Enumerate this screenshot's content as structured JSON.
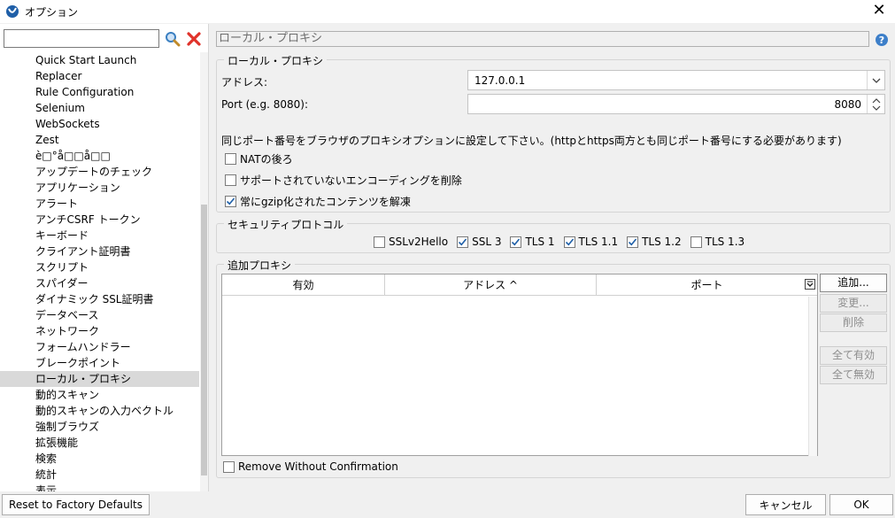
{
  "window": {
    "title": "オプション",
    "close_glyph": "✕"
  },
  "sidebar": {
    "search": {
      "value": "",
      "placeholder": ""
    },
    "items": [
      {
        "label": "Quick Start Launch"
      },
      {
        "label": "Replacer"
      },
      {
        "label": "Rule Configuration"
      },
      {
        "label": "Selenium"
      },
      {
        "label": "WebSockets"
      },
      {
        "label": "Zest"
      },
      {
        "label": "è□°å□□å□□"
      },
      {
        "label": "アップデートのチェック"
      },
      {
        "label": "アプリケーション"
      },
      {
        "label": "アラート"
      },
      {
        "label": "アンチCSRF トークン"
      },
      {
        "label": "キーボード"
      },
      {
        "label": "クライアント証明書"
      },
      {
        "label": "スクリプト"
      },
      {
        "label": "スパイダー"
      },
      {
        "label": "ダイナミック SSL証明書"
      },
      {
        "label": "データベース"
      },
      {
        "label": "ネットワーク"
      },
      {
        "label": "フォームハンドラー"
      },
      {
        "label": "ブレークポイント"
      },
      {
        "label": "ローカル・プロキシ",
        "selected": true
      },
      {
        "label": "動的スキャン"
      },
      {
        "label": "動的スキャンの入力ベクトル"
      },
      {
        "label": "強制ブラウズ"
      },
      {
        "label": "拡張機能"
      },
      {
        "label": "検索"
      },
      {
        "label": "統計"
      },
      {
        "label": "表示"
      }
    ]
  },
  "panel": {
    "title": "ローカル・プロキシ",
    "local_proxy": {
      "legend": "ローカル・プロキシ",
      "address_label": "アドレス:",
      "address_value": "127.0.0.1",
      "port_label": "Port (e.g. 8080):",
      "port_value": "8080",
      "note": "同じポート番号をブラウザのプロキシオプションに設定して下さい。(httpとhttps両方とも同じポート番号にする必要があります)",
      "options": [
        {
          "label": "NATの後ろ",
          "checked": false
        },
        {
          "label": "サポートされていないエンコーディングを削除",
          "checked": false
        },
        {
          "label": "常にgzip化されたコンテンツを解凍",
          "checked": true
        }
      ]
    },
    "security": {
      "legend": "セキュリティプロトコル",
      "protocols": [
        {
          "label": "SSLv2Hello",
          "checked": false
        },
        {
          "label": "SSL 3",
          "checked": true
        },
        {
          "label": "TLS 1",
          "checked": true
        },
        {
          "label": "TLS 1.1",
          "checked": true
        },
        {
          "label": "TLS 1.2",
          "checked": true
        },
        {
          "label": "TLS 1.3",
          "checked": false
        }
      ]
    },
    "additional": {
      "legend": "追加プロキシ",
      "columns": [
        "有効",
        "アドレス ^",
        "ポート"
      ],
      "buttons": {
        "add": "追加...",
        "modify": "変更...",
        "remove": "削除",
        "enable_all": "全て有効",
        "disable_all": "全て無効"
      },
      "remove_without_confirmation": {
        "label": "Remove Without Confirmation",
        "checked": false
      }
    }
  },
  "footer": {
    "reset": "Reset to Factory Defaults",
    "cancel": "キャンセル",
    "ok": "OK"
  }
}
